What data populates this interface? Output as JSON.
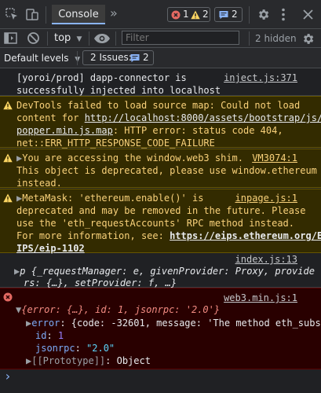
{
  "toolbar": {
    "tab_console": "Console",
    "more_tabs_glyph": "»",
    "error_count": "1",
    "warning_count": "2",
    "message_count": "2"
  },
  "filterbar": {
    "context": "top",
    "filter_placeholder": "Filter",
    "hidden_label": "2 hidden"
  },
  "levelsbar": {
    "levels_label": "Default levels",
    "issues_label": "2 Issues:",
    "issues_count": "2"
  },
  "messages": {
    "m1": {
      "lines": [
        "[yoroi/prod] dapp-connector is",
        "successfully injected into localhost"
      ],
      "source": "inject.js:371"
    },
    "m2": {
      "line1": "DevTools failed to load source map: Could not load",
      "line2_pre": "content for ",
      "line2_link": "http://localhost:8000/assets/bootstrap/js/",
      "line3_link": "popper.min.js.map",
      "line3_post": ": HTTP error: status code 404,",
      "line4": "net::ERR_HTTP_RESPONSE_CODE_FAILURE"
    },
    "m3": {
      "line1": "You are accessing the window.web3 shim.",
      "source": "VM3074:1",
      "line2": "This object is deprecated, please use window.ethereum",
      "line3": "instead."
    },
    "m4": {
      "line1": "MetaMask: 'ethereum.enable()' is",
      "source": "inpage.js:1",
      "line2": "deprecated and may be removed in the future. Please",
      "line3": "use the 'eth_requestAccounts' RPC method instead.",
      "line4_pre": "For more information, see: ",
      "line4_link": "https://eips.ethereum.org/E",
      "line5_link": "IPS/eip-1102"
    },
    "m5": {
      "source": "index.js:13",
      "line1_p": "p ",
      "line1_rest": "{_requestManager: e, givenProvider: Proxy, provide",
      "line2": "rs: {…}, setProvider: f, …}"
    },
    "m6": {
      "source": "web3.min.js:1",
      "line1": "{error: {…}, id: 1, jsonrpc: '2.0'}",
      "err_key": "error",
      "err_val": ": {code: -32601, message: 'The method eth_subs",
      "id_key": "id",
      "id_val": "1",
      "jsonrpc_key": "jsonrpc",
      "jsonrpc_val": "\"2.0\"",
      "proto_key": "[[Prototype]]",
      "proto_val": ": Object"
    }
  },
  "prompt_glyph": "›"
}
